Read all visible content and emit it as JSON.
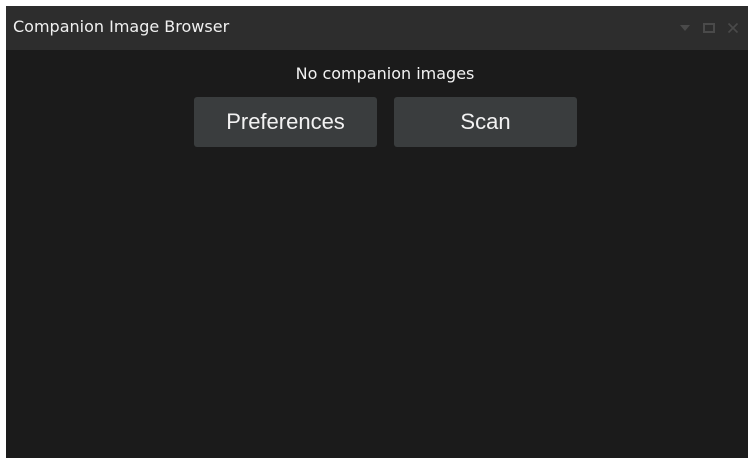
{
  "window": {
    "title": "Companion Image Browser",
    "controls": [
      {
        "name": "dropdown-arrow-icon",
        "glyph": "triangle-down"
      },
      {
        "name": "maximize-icon",
        "glyph": "square"
      },
      {
        "name": "close-icon",
        "glyph": "x"
      }
    ]
  },
  "main": {
    "status_text": "No companion images",
    "buttons": {
      "preferences_label": "Preferences",
      "scan_label": "Scan"
    }
  },
  "colors": {
    "panel_background": "#1b1b1b",
    "titlebar_background": "#2d2d2d",
    "button_background": "#3a3d3e",
    "text": "#f2f2f2",
    "control_icons": "#4a4a4a"
  }
}
